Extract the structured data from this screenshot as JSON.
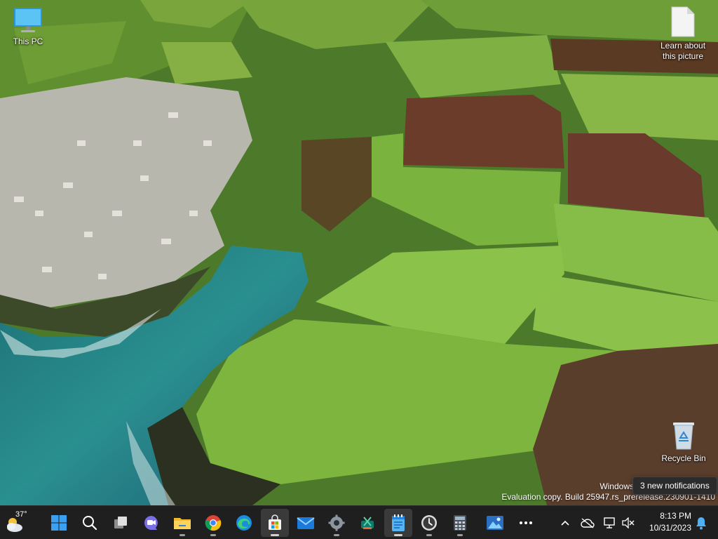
{
  "desktop": {
    "icons": {
      "this_pc": "This PC",
      "learn_line1": "Learn about",
      "learn_line2": "this picture",
      "recycle_bin": "Recycle Bin"
    },
    "watermark": {
      "line1": "Windows",
      "line2": "Evaluation copy. Build 25947.rs_prerelease.230901-1410"
    }
  },
  "notification_tooltip": "3 new notifications",
  "taskbar": {
    "weather_temp": "37°",
    "apps": [
      {
        "name": "start",
        "icon": "windows-logo-icon"
      },
      {
        "name": "search",
        "icon": "search-icon"
      },
      {
        "name": "task-view",
        "icon": "task-view-icon"
      },
      {
        "name": "chat",
        "icon": "chat-camera-icon"
      },
      {
        "name": "file-explorer",
        "icon": "folder-icon"
      },
      {
        "name": "chrome",
        "icon": "chrome-icon"
      },
      {
        "name": "edge",
        "icon": "edge-icon"
      },
      {
        "name": "store",
        "icon": "store-bag-icon"
      },
      {
        "name": "mail",
        "icon": "mail-icon"
      },
      {
        "name": "settings",
        "icon": "gear-icon"
      },
      {
        "name": "snipping",
        "icon": "snip-icon"
      },
      {
        "name": "notepad",
        "icon": "notepad-icon"
      },
      {
        "name": "clock",
        "icon": "clock-icon"
      },
      {
        "name": "calculator",
        "icon": "calculator-icon"
      },
      {
        "name": "photos",
        "icon": "photos-icon"
      },
      {
        "name": "more",
        "icon": "ellipsis-icon"
      }
    ],
    "tray": {
      "time": "8:13 PM",
      "date": "10/31/2023"
    }
  },
  "colors": {
    "taskbar_bg": "#1f1f1f",
    "accent_blue": "#3aa0f3",
    "notepad_accent": "#1e88e5"
  }
}
